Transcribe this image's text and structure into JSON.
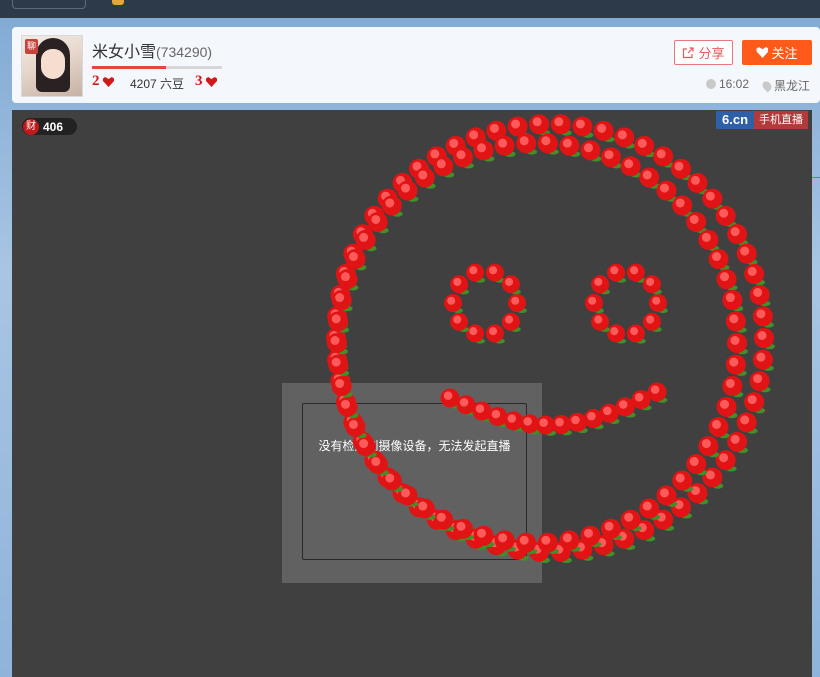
{
  "streamer": {
    "name": "米女小雪",
    "id": "(734290)",
    "avatar_stamp": "聊",
    "level_left": "2",
    "level_right": "3",
    "level_progress": 0.57,
    "beans": "4207 六豆"
  },
  "actions": {
    "share_label": "分享",
    "follow_label": "关注"
  },
  "meta": {
    "time": "16:02",
    "location": "黑龙江"
  },
  "stage": {
    "wealth_icon": "财",
    "wealth_value": "406",
    "brand_logo": "6.cn",
    "brand_tag": "手机直播",
    "notice": "没有检测到摄像设备，无法发起直播"
  },
  "colors": {
    "accent_orange": "#ff5a1a",
    "rose_red": "#e01414",
    "stage_bg": "#404040"
  },
  "icons": [
    "share-icon",
    "heart-icon",
    "clock-icon",
    "location-pin-icon"
  ]
}
